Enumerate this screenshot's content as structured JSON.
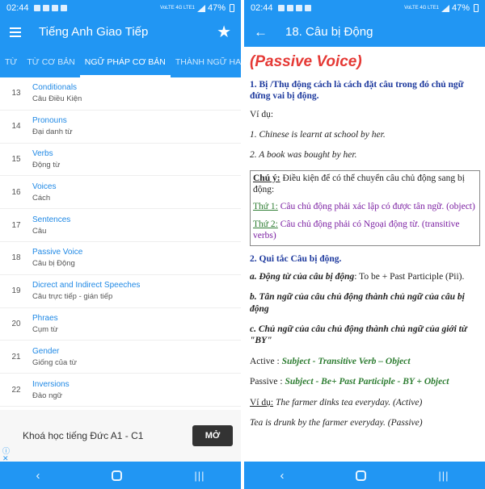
{
  "status": {
    "time": "02:44",
    "battery": "47%",
    "network": "VoLTE 4G LTE1"
  },
  "left": {
    "title": "Tiếng Anh Giao Tiếp",
    "tabs": [
      "TỪ",
      "TỪ CƠ BẢN",
      "NGỮ PHÁP CƠ BẢN",
      "THÀNH NGỮ HAY"
    ],
    "active_tab": 2,
    "items": [
      {
        "num": "13",
        "en": "Conditionals",
        "vi": "Câu Điều Kiện"
      },
      {
        "num": "14",
        "en": "Pronouns",
        "vi": "Đại danh từ"
      },
      {
        "num": "15",
        "en": "Verbs",
        "vi": "Động từ"
      },
      {
        "num": "16",
        "en": "Voices",
        "vi": "Cách"
      },
      {
        "num": "17",
        "en": "Sentences",
        "vi": "Câu"
      },
      {
        "num": "18",
        "en": "Passive Voice",
        "vi": "Câu bị Động"
      },
      {
        "num": "19",
        "en": "Dicrect and Indirect Speeches",
        "vi": "Câu trực tiếp - gián tiếp"
      },
      {
        "num": "20",
        "en": "Phraes",
        "vi": "Cụm từ"
      },
      {
        "num": "21",
        "en": "Gender",
        "vi": "Giống của từ"
      },
      {
        "num": "22",
        "en": "Inversions",
        "vi": "Đảo ngữ"
      }
    ],
    "ad": {
      "text": "Khoá học tiếng Đức A1 - C1",
      "button": "MỞ"
    }
  },
  "right": {
    "title": "18. Câu bị Động",
    "heading": "(Passive Voice)",
    "sec1": "1. Bị /Thụ động cách là cách đặt câu trong đó chủ ngữ đứng vai bị động.",
    "example_label": "Ví dụ:",
    "ex1": "1. Chinese is learnt at school by her.",
    "ex2": "2. A book was bought by her.",
    "note_label": "Chú ý:",
    "note_text": " Điều kiện để có thể chuyển câu chủ động sang bị động:",
    "cond1_label": "Thứ 1:",
    "cond1_text": " Câu chủ động phải xác lập có được tân ngữ. (object)",
    "cond2_label": "Thứ 2:",
    "cond2_text": " Câu chủ động phải có Ngoại động từ. (transitive verbs)",
    "sec2": "2. Qui tắc Câu bị động.",
    "rule_a_label": "a. Động từ của câu bị động",
    "rule_a_text": ": To be + Past Participle (Pii).",
    "rule_b": "b. Tân ngữ của câu chủ động thành chủ ngữ của câu bị động",
    "rule_c": "c. Chủ ngữ của câu chủ động thành chủ ngữ của giới từ \"BY\"",
    "active_label": "Active : ",
    "active_rule": "Subject - Transitive Verb – Object",
    "passive_label": "Passive : ",
    "passive_rule": "Subject - Be+ Past Participle - BY + Object",
    "ex_label": "Ví dụ:",
    "ex3": " The farmer dinks tea everyday. (Active)",
    "ex4": "Tea is drunk by the farmer everyday. (Passive)"
  },
  "colors": {
    "primary": "#2196f3",
    "heading": "#e53935",
    "section": "#1e3a9e",
    "green": "#2e7d32",
    "purple": "#7b1fa2"
  },
  "icons": [
    "menu-icon",
    "star-icon",
    "back-arrow-icon",
    "info-icon",
    "close-icon",
    "nav-back-icon",
    "nav-home-icon",
    "nav-recent-icon"
  ]
}
